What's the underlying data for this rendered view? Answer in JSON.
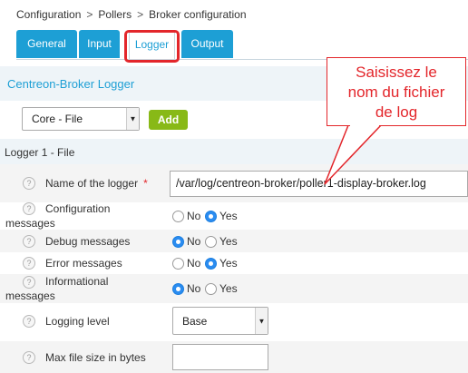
{
  "breadcrumb": {
    "items": [
      "Configuration",
      "Pollers",
      "Broker configuration"
    ],
    "separator": ">"
  },
  "tabs": [
    {
      "label": "General",
      "active": false
    },
    {
      "label": "Input",
      "active": false
    },
    {
      "label": "Logger",
      "active": true
    },
    {
      "label": "Output",
      "active": false
    }
  ],
  "section": {
    "title": "Centreon-Broker Logger",
    "type_select": "Core - File",
    "add_label": "Add"
  },
  "logger": {
    "group_title": "Logger 1 - File",
    "name_label": "Name of the logger",
    "required_mark": "*",
    "name_value": "/var/log/centreon-broker/poller1-display-broker.log",
    "config_label_1": "Configuration",
    "config_label_2": "messages",
    "debug_label": "Debug messages",
    "error_label": "Error messages",
    "info_label_1": "Informational",
    "info_label_2": "messages",
    "logging_level_label": "Logging level",
    "logging_level_value": "Base",
    "max_size_label": "Max file size in bytes",
    "max_size_value": "",
    "no_label": "No",
    "yes_label": "Yes",
    "help_glyph": "?",
    "settings": {
      "configuration_messages": "Yes",
      "debug_messages": "No",
      "error_messages": "Yes",
      "informational_messages": "No"
    }
  },
  "callout": {
    "text": "Saisissez le\nnom du fichier\nde log",
    "color": "#e3262b"
  },
  "colors": {
    "accent": "#1d9fd5",
    "add_button": "#88b917",
    "highlight": "#e3262b",
    "radio_selected": "#2b8cf0"
  },
  "icons": {
    "help": "question-circle-icon",
    "dropdown": "chevron-down-icon"
  }
}
